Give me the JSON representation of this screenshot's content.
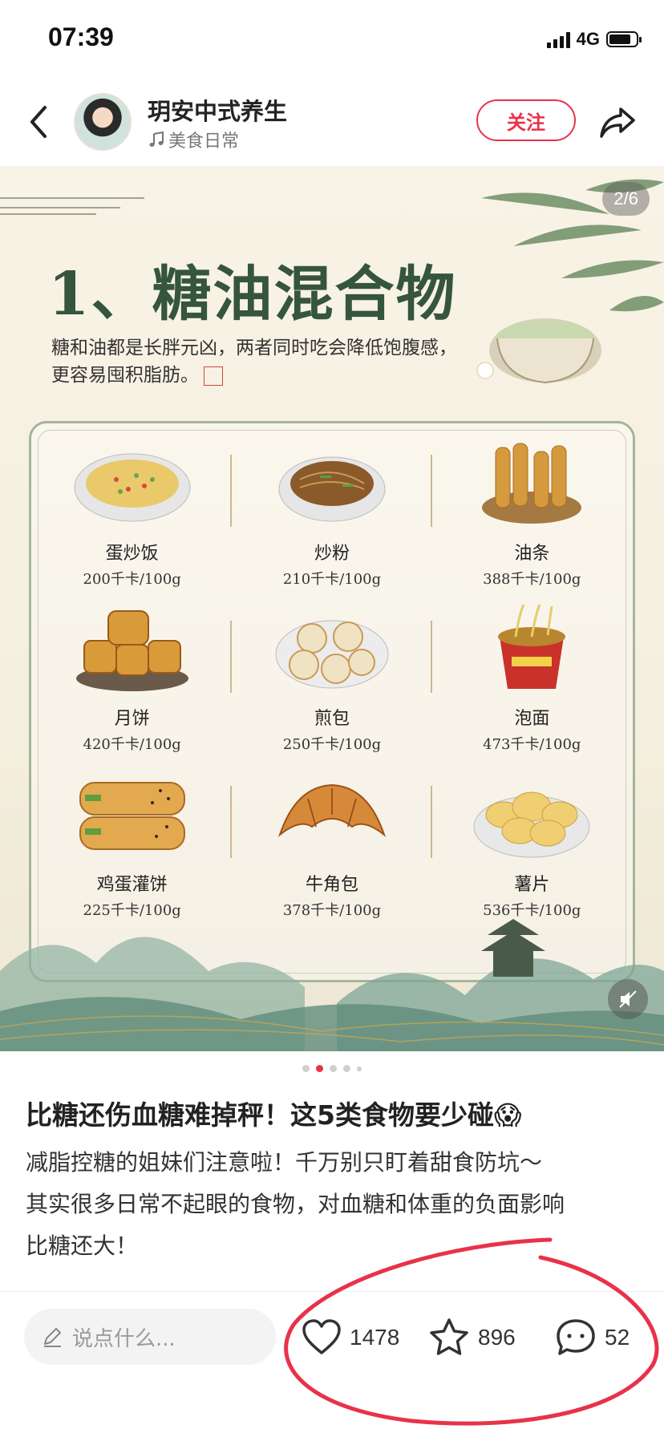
{
  "status_bar": {
    "time": "07:39",
    "network": "4G"
  },
  "header": {
    "author_name": "玥安中式养生",
    "author_tag": "美食日常",
    "follow_label": "关注"
  },
  "poster": {
    "page_indicator": "2/6",
    "title": "1、糖油混合物",
    "desc_line1": "糖和油都是长胖元凶，两者同时吃会降低饱腹感，",
    "desc_line2": "更容易囤积脂肪。",
    "foods": [
      {
        "name": "蛋炒饭",
        "kcal": "200千卡/100g"
      },
      {
        "name": "炒粉",
        "kcal": "210千卡/100g"
      },
      {
        "name": "油条",
        "kcal": "388千卡/100g"
      },
      {
        "name": "月饼",
        "kcal": "420千卡/100g"
      },
      {
        "name": "煎包",
        "kcal": "250千卡/100g"
      },
      {
        "name": "泡面",
        "kcal": "473千卡/100g"
      },
      {
        "name": "鸡蛋灌饼",
        "kcal": "225千卡/100g"
      },
      {
        "name": "牛角包",
        "kcal": "378千卡/100g"
      },
      {
        "name": "薯片",
        "kcal": "536千卡/100g"
      }
    ]
  },
  "carousel": {
    "total_dots": 5,
    "active_dot": 1
  },
  "post": {
    "title": "比糖还伤血糖难掉秤！这5类食物要少碰😱",
    "body_line1": "减脂控糖的姐妹们注意啦！千万别只盯着甜食防坑～",
    "body_line2": "其实很多日常不起眼的食物，对血糖和体重的负面影响",
    "body_line3": "比糖还大！"
  },
  "bottom_bar": {
    "comment_placeholder": "说点什么...",
    "likes": "1478",
    "favorites": "896",
    "comments": "52"
  },
  "colors": {
    "accent": "#e8324a",
    "poster_green": "#35553c",
    "annotation_red": "#e8324a"
  }
}
